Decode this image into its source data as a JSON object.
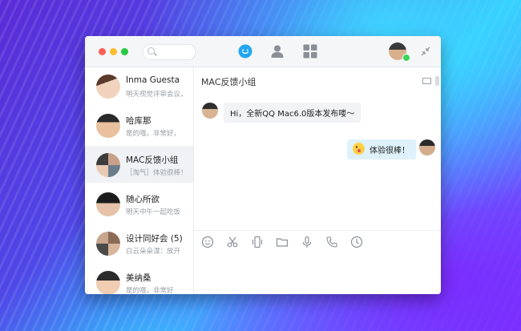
{
  "window": {
    "search_placeholder": ""
  },
  "nav": {
    "messages_icon": "chat-bubble-icon",
    "contacts_icon": "contact-icon",
    "apps_icon": "grid-icon"
  },
  "conversations": [
    {
      "name": "Inma Guesta",
      "preview": "明天视觉评审会议，"
    },
    {
      "name": "哈库那",
      "preview": "是的哦，非常好，"
    },
    {
      "name": "MAC反馈小组",
      "preview": "［淘气］体验很棒！"
    },
    {
      "name": "随心所欲",
      "preview": "明天中午一起吃饭"
    },
    {
      "name": "设计同好会 (5)",
      "preview": "白云朵朵漂：放开"
    },
    {
      "name": "美纳桑",
      "preview": "是的哦，非常好"
    }
  ],
  "chat": {
    "title": "MAC反馈小组",
    "incoming": "Hi，全新QQ Mac6.0版本发布喽～",
    "outgoing": "体验很棒！"
  },
  "toolbar": {
    "icons": [
      "emoji-icon",
      "scissors-icon",
      "phone-shake-icon",
      "folder-icon",
      "microphone-icon",
      "call-icon",
      "history-icon"
    ]
  },
  "colors": {
    "accent": "#22a6f2",
    "traffic_red": "#fc5f57",
    "traffic_yellow": "#fdbc2e",
    "traffic_green": "#27c840",
    "online": "#3bd35c"
  }
}
